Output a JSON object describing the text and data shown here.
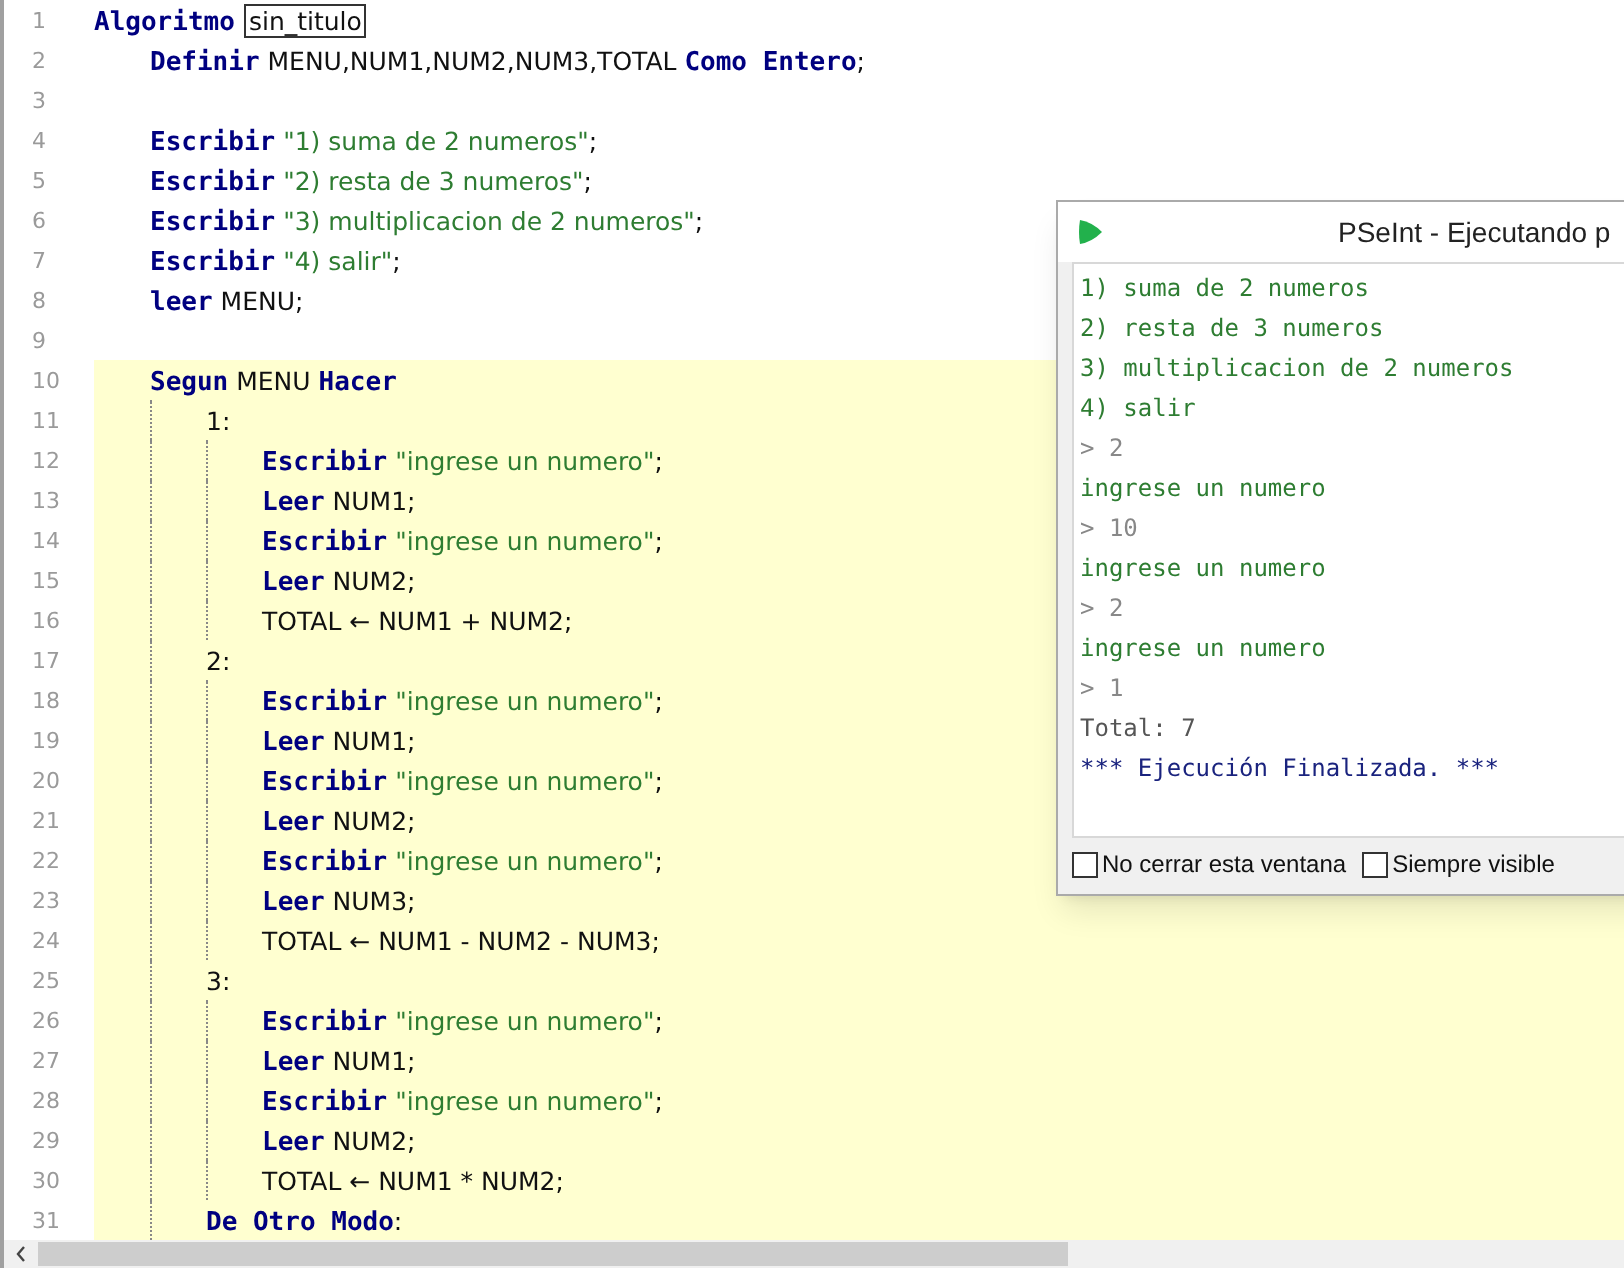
{
  "editor": {
    "lines": [
      {
        "number": "1",
        "tokens": [
          {
            "kind": "kw",
            "text": "Algoritmo"
          },
          {
            "kind": "boxed",
            "text": "sin_titulo"
          }
        ],
        "children": [
          {
            "number": "2",
            "tokens": [
              {
                "kind": "kw",
                "text": "Definir"
              },
              {
                "kind": "plain",
                "text": " MENU,NUM1,NUM2,NUM3,TOTAL "
              },
              {
                "kind": "kw",
                "text": "Como Entero"
              },
              {
                "kind": "plain",
                "text": ";"
              }
            ]
          },
          {
            "number": "3"
          },
          {
            "number": "4",
            "tokens": [
              {
                "kind": "kw",
                "text": "Escribir"
              },
              {
                "kind": "str",
                "text": " \"1) suma de 2 numeros\""
              },
              {
                "kind": "plain",
                "text": ";"
              }
            ]
          },
          {
            "number": "5",
            "tokens": [
              {
                "kind": "kw",
                "text": "Escribir"
              },
              {
                "kind": "str",
                "text": " \"2) resta de 3 numeros\""
              },
              {
                "kind": "plain",
                "text": ";"
              }
            ]
          },
          {
            "number": "6",
            "tokens": [
              {
                "kind": "kw",
                "text": "Escribir"
              },
              {
                "kind": "str",
                "text": " \"3) multiplicacion de 2 numeros\""
              },
              {
                "kind": "plain",
                "text": ";"
              }
            ]
          },
          {
            "number": "7",
            "tokens": [
              {
                "kind": "kw",
                "text": "Escribir"
              },
              {
                "kind": "str",
                "text": " \"4) salir\""
              },
              {
                "kind": "plain",
                "text": ";"
              }
            ]
          },
          {
            "number": "8",
            "tokens": [
              {
                "kind": "kw",
                "text": "leer"
              },
              {
                "kind": "plain",
                "text": " MENU;"
              }
            ]
          },
          {
            "number": "9"
          },
          {
            "number": "10",
            "highlighted": true,
            "tokens": [
              {
                "kind": "kw",
                "text": "Segun"
              },
              {
                "kind": "plain",
                "text": " MENU "
              },
              {
                "kind": "kw",
                "text": "Hacer"
              }
            ],
            "children": [
              {
                "number": "11",
                "tokens": [
                  {
                    "kind": "plain",
                    "text": "1:"
                  }
                ],
                "children": [
                  {
                    "number": "12",
                    "tokens": [
                      {
                        "kind": "kw",
                        "text": "Escribir"
                      },
                      {
                        "kind": "str",
                        "text": " \"ingrese un numero\""
                      },
                      {
                        "kind": "plain",
                        "text": ";"
                      }
                    ]
                  },
                  {
                    "number": "13",
                    "tokens": [
                      {
                        "kind": "kw",
                        "text": "Leer"
                      },
                      {
                        "kind": "plain",
                        "text": " NUM1;"
                      }
                    ]
                  },
                  {
                    "number": "14",
                    "tokens": [
                      {
                        "kind": "kw",
                        "text": "Escribir"
                      },
                      {
                        "kind": "str",
                        "text": " \"ingrese un numero\""
                      },
                      {
                        "kind": "plain",
                        "text": ";"
                      }
                    ]
                  },
                  {
                    "number": "15",
                    "tokens": [
                      {
                        "kind": "kw",
                        "text": "Leer"
                      },
                      {
                        "kind": "plain",
                        "text": " NUM2;"
                      }
                    ]
                  },
                  {
                    "number": "16",
                    "tokens": [
                      {
                        "kind": "plain",
                        "text": "TOTAL ← NUM1 + NUM2;"
                      }
                    ]
                  }
                ]
              },
              {
                "number": "17",
                "tokens": [
                  {
                    "kind": "plain",
                    "text": "2:"
                  }
                ],
                "children": [
                  {
                    "number": "18",
                    "tokens": [
                      {
                        "kind": "kw",
                        "text": "Escribir"
                      },
                      {
                        "kind": "str",
                        "text": " \"ingrese un numero\""
                      },
                      {
                        "kind": "plain",
                        "text": ";"
                      }
                    ]
                  },
                  {
                    "number": "19",
                    "tokens": [
                      {
                        "kind": "kw",
                        "text": "Leer"
                      },
                      {
                        "kind": "plain",
                        "text": " NUM1;"
                      }
                    ]
                  },
                  {
                    "number": "20",
                    "tokens": [
                      {
                        "kind": "kw",
                        "text": "Escribir"
                      },
                      {
                        "kind": "str",
                        "text": " \"ingrese un numero\""
                      },
                      {
                        "kind": "plain",
                        "text": ";"
                      }
                    ]
                  },
                  {
                    "number": "21",
                    "tokens": [
                      {
                        "kind": "kw",
                        "text": "Leer"
                      },
                      {
                        "kind": "plain",
                        "text": " NUM2;"
                      }
                    ]
                  },
                  {
                    "number": "22",
                    "tokens": [
                      {
                        "kind": "kw",
                        "text": "Escribir"
                      },
                      {
                        "kind": "str",
                        "text": " \"ingrese un numero\""
                      },
                      {
                        "kind": "plain",
                        "text": ";"
                      }
                    ]
                  },
                  {
                    "number": "23",
                    "tokens": [
                      {
                        "kind": "kw",
                        "text": "Leer"
                      },
                      {
                        "kind": "plain",
                        "text": " NUM3;"
                      }
                    ]
                  },
                  {
                    "number": "24",
                    "tokens": [
                      {
                        "kind": "plain",
                        "text": "TOTAL ← NUM1 - NUM2 - NUM3;"
                      }
                    ]
                  }
                ]
              },
              {
                "number": "25",
                "tokens": [
                  {
                    "kind": "plain",
                    "text": "3:"
                  }
                ],
                "children": [
                  {
                    "number": "26",
                    "tokens": [
                      {
                        "kind": "kw",
                        "text": "Escribir"
                      },
                      {
                        "kind": "str",
                        "text": " \"ingrese un numero\""
                      },
                      {
                        "kind": "plain",
                        "text": ";"
                      }
                    ]
                  },
                  {
                    "number": "27",
                    "tokens": [
                      {
                        "kind": "kw",
                        "text": "Leer"
                      },
                      {
                        "kind": "plain",
                        "text": " NUM1;"
                      }
                    ]
                  },
                  {
                    "number": "28",
                    "tokens": [
                      {
                        "kind": "kw",
                        "text": "Escribir"
                      },
                      {
                        "kind": "str",
                        "text": " \"ingrese un numero\""
                      },
                      {
                        "kind": "plain",
                        "text": ";"
                      }
                    ]
                  },
                  {
                    "number": "29",
                    "tokens": [
                      {
                        "kind": "kw",
                        "text": "Leer"
                      },
                      {
                        "kind": "plain",
                        "text": " NUM2;"
                      }
                    ]
                  },
                  {
                    "number": "30",
                    "tokens": [
                      {
                        "kind": "plain",
                        "text": "TOTAL ← NUM1 * NUM2;"
                      }
                    ]
                  }
                ]
              },
              {
                "number": "31",
                "tokens": [
                  {
                    "kind": "kw",
                    "text": "De Otro Modo"
                  },
                  {
                    "kind": "plain",
                    "text": ":"
                  }
                ]
              }
            ]
          }
        ]
      }
    ]
  },
  "run_window": {
    "title": "PSeInt - Ejecutando p",
    "output": [
      {
        "kind": "output",
        "text": "1) suma de 2 numeros"
      },
      {
        "kind": "output",
        "text": "2) resta de 3 numeros"
      },
      {
        "kind": "output",
        "text": "3) multiplicacion de 2 numeros"
      },
      {
        "kind": "output",
        "text": "4) salir"
      },
      {
        "kind": "input",
        "text": "> 2"
      },
      {
        "kind": "output",
        "text": "ingrese un numero"
      },
      {
        "kind": "input",
        "text": "> 10"
      },
      {
        "kind": "output",
        "text": "ingrese un numero"
      },
      {
        "kind": "input",
        "text": "> 2"
      },
      {
        "kind": "output",
        "text": "ingrese un numero"
      },
      {
        "kind": "input",
        "text": "> 1"
      },
      {
        "kind": "result",
        "text": "Total: 7"
      },
      {
        "kind": "status",
        "text": "*** Ejecución Finalizada. ***"
      }
    ],
    "options": [
      {
        "label": "No cerrar esta ventana",
        "checked": false
      },
      {
        "label": "Siempre visible",
        "checked": false
      }
    ]
  }
}
